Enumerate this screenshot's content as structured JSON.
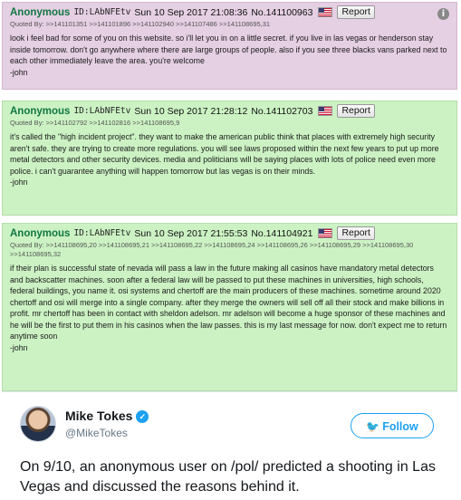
{
  "posts": [
    {
      "name": "Anonymous",
      "uid": "ID:LAbNFEtv",
      "date": "Sun 10 Sep 2017 21:08:36",
      "no": "No.141100963",
      "report": "Report",
      "quoted": "Quoted By: >>141101351 >>141101896 >>141102940 >>141107486 >>141108695,31",
      "body": "look i feel bad for some of you on this website. so i'll let you in on a little secret. if you live in las vegas or henderson stay inside tomorrow. don't go anywhere where there are large groups of people. also if you see three blacks vans parked next to each other immediately leave the area. you're welcome\n-john"
    },
    {
      "name": "Anonymous",
      "uid": "ID:LAbNFEtv",
      "date": "Sun 10 Sep 2017 21:28:12",
      "no": "No.141102703",
      "report": "Report",
      "quoted": "Quoted By: >>141102792 >>141102816 >>141108695,9",
      "body": "it's called the \"high incident project\". they want to make the american public think that places with extremely high security aren't safe. they are trying to create more regulations. you will see laws proposed within the next few years to put up more metal detectors and other security devices. media and politicians will be saying places with lots of police need even more police. i can't guarantee anything will happen tomorrow but las vegas is on their minds.\n-john"
    },
    {
      "name": "Anonymous",
      "uid": "ID:LAbNFEtv",
      "date": "Sun 10 Sep 2017 21:55:53",
      "no": "No.141104921",
      "report": "Report",
      "quoted": "Quoted By: >>141108695,20 >>141108695,21 >>141108695,22 >>141108695,24 >>141108695,26 >>141108695,29 >>141108695,30 >>141108695,32",
      "body": "if their plan is successful state of nevada will pass a law in the future making all casinos have mandatory metal detectors and backscatter machines. soon after a federal law will be passed to put these machines in universities, high schools, federal buildings, you name it. osi systems and chertoff are the main producers of these machines. sometime around 2020 chertoff and osi will merge into a single company. after they merge the owners will sell off all their stock and make billions in profit. mr chertoff has been in contact with sheldon adelson. mr adelson will become a huge sponsor of these machines and he will be the first to put them in his casinos when the law passes. this is my last message for now. don't expect me to return anytime soon\n-john"
    }
  ],
  "tweet": {
    "name": "Mike Tokes",
    "handle": "@MikeTokes",
    "follow_label": "Follow",
    "text": "On 9/10, an anonymous user on /pol/ predicted a shooting in Las Vegas and discussed the reasons behind it."
  },
  "icons": {
    "info": "info-icon",
    "flag": "us-flag-icon",
    "verified": "verified-badge-icon",
    "twitter": "twitter-bird-icon"
  },
  "colors": {
    "post1_bg": "#e5cfe3",
    "post_bg": "#ccf2c4",
    "name_green": "#117743",
    "twitter_blue": "#1da1f2"
  }
}
